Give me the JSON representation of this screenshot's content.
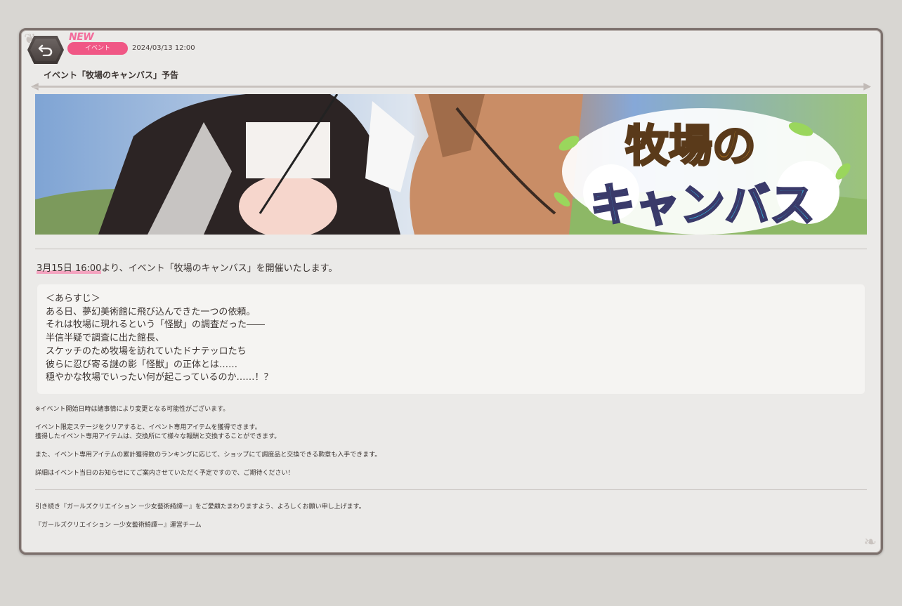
{
  "header": {
    "new_label": "NEW",
    "category": "イベント",
    "date": "2024/03/13 12:00",
    "title": "イベント「牧場のキャンバス」予告"
  },
  "banner": {
    "logo_line1": "牧場の",
    "logo_line2": "キャンバス"
  },
  "body": {
    "lead_highlight": "3月15日 16:00",
    "lead_rest": "より、イベント「牧場のキャンバス」を開催いたします。",
    "synopsis": [
      "＜あらすじ＞",
      "ある日、夢幻美術館に飛び込んできた一つの依頼。",
      "それは牧場に現れるという「怪獣」の調査だった――",
      "半信半疑で調査に出た館長、",
      "スケッチのため牧場を訪れていたドナテッロたち",
      "彼らに忍び寄る謎の影「怪獣」の正体とは……",
      "穏やかな牧場でいったい何が起こっているのか……！？"
    ],
    "note1": "※イベント開始日時は諸事情により変更となる可能性がございます。",
    "note2a": "イベント限定ステージをクリアすると、イベント専用アイテムを獲得できます。",
    "note2b": "獲得したイベント専用アイテムは、交換所にて様々な報酬と交換することができます。",
    "note3": "また、イベント専用アイテムの累計獲得数のランキングに応じて、ショップにて調度品と交換できる勲章も入手できます。",
    "note4": "詳細はイベント当日のお知らせにてご案内させていただく予定ですので、ご期待ください！",
    "closing": "引き続き『ガールズクリエイション ー少女藝術綺譚ー』をご愛顧たまわりますよう、よろしくお願い申し上げます。",
    "signature": "『ガールズクリエイション ー少女藝術綺譚ー』運営チーム"
  },
  "colors": {
    "accent_pink": "#f05785",
    "panel_bg": "#ebeae8",
    "border": "#7d716d"
  },
  "icons": {
    "back": "back-arrow-icon"
  }
}
